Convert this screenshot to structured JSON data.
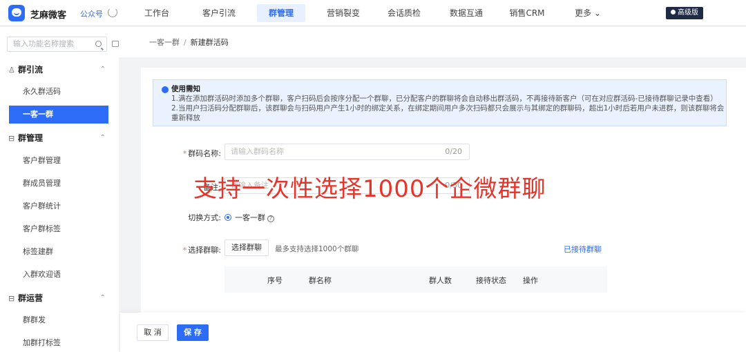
{
  "topbar": {
    "app_name": "芝麻微客",
    "account": "公众号",
    "nav": [
      {
        "label": "工作台"
      },
      {
        "label": "客户引流"
      },
      {
        "label": "群管理"
      },
      {
        "label": "营销裂变"
      },
      {
        "label": "会话质检"
      },
      {
        "label": "数据互通"
      },
      {
        "label": "销售CRM"
      },
      {
        "label": "更多 ⌄"
      }
    ],
    "active_nav": 2,
    "badge": "高级版"
  },
  "sidebar": {
    "search_placeholder": "输入功能名称搜索",
    "groups": [
      {
        "title": "群引流",
        "icon": "♙",
        "items": [
          "永久群活码",
          "一客一群"
        ]
      },
      {
        "title": "群管理",
        "icon": "⊟",
        "items": [
          "客户群管理",
          "群成员管理",
          "客户群统计",
          "客户群标签",
          "标签建群",
          "入群欢迎语"
        ]
      },
      {
        "title": "群运营",
        "icon": "⊟",
        "items": [
          "群群发",
          "加群打标签"
        ]
      }
    ],
    "active_item": "一客一群"
  },
  "breadcrumb": {
    "parent": "一客一群",
    "separator": "/",
    "current": "新建群活码"
  },
  "notice": {
    "title": "使用需知",
    "line1": "1.满在添加群活码时添加多个群聊，客户扫码后会按序分配一个群聊，已分配客户的群聊将会自动移出群活码，不再接待新客户（可在对应群活码-已接待群聊记录中查看）",
    "line2": "2.当用户扫活码分配群聊后，该群聊会与扫码用户产生1小时的绑定关系，在绑定期间用户多次扫码都只会展示与其绑定的群聊码，超出1小时后若用户未进群，则该群聊将会重新释放"
  },
  "form": {
    "name_label": "群码名称:",
    "name_placeholder": "请输入群码名称",
    "name_count": "0/20",
    "remark_label": "备注:",
    "remark_placeholder": "请输入备注",
    "remark_count": "0/30",
    "mode_label": "切换方式:",
    "mode_option": "一客一群",
    "select_label": "选择群聊:",
    "select_button": "选择群聊",
    "select_hint": "最多支持选择1000个群聊",
    "received_link": "已接待群聊"
  },
  "table": {
    "columns": [
      "序号",
      "群名称",
      "群人数",
      "接待状态",
      "操作"
    ]
  },
  "overlay": "支持一次性选择1000个企微群聊",
  "footer": {
    "cancel": "取 消",
    "save": "保 存"
  }
}
